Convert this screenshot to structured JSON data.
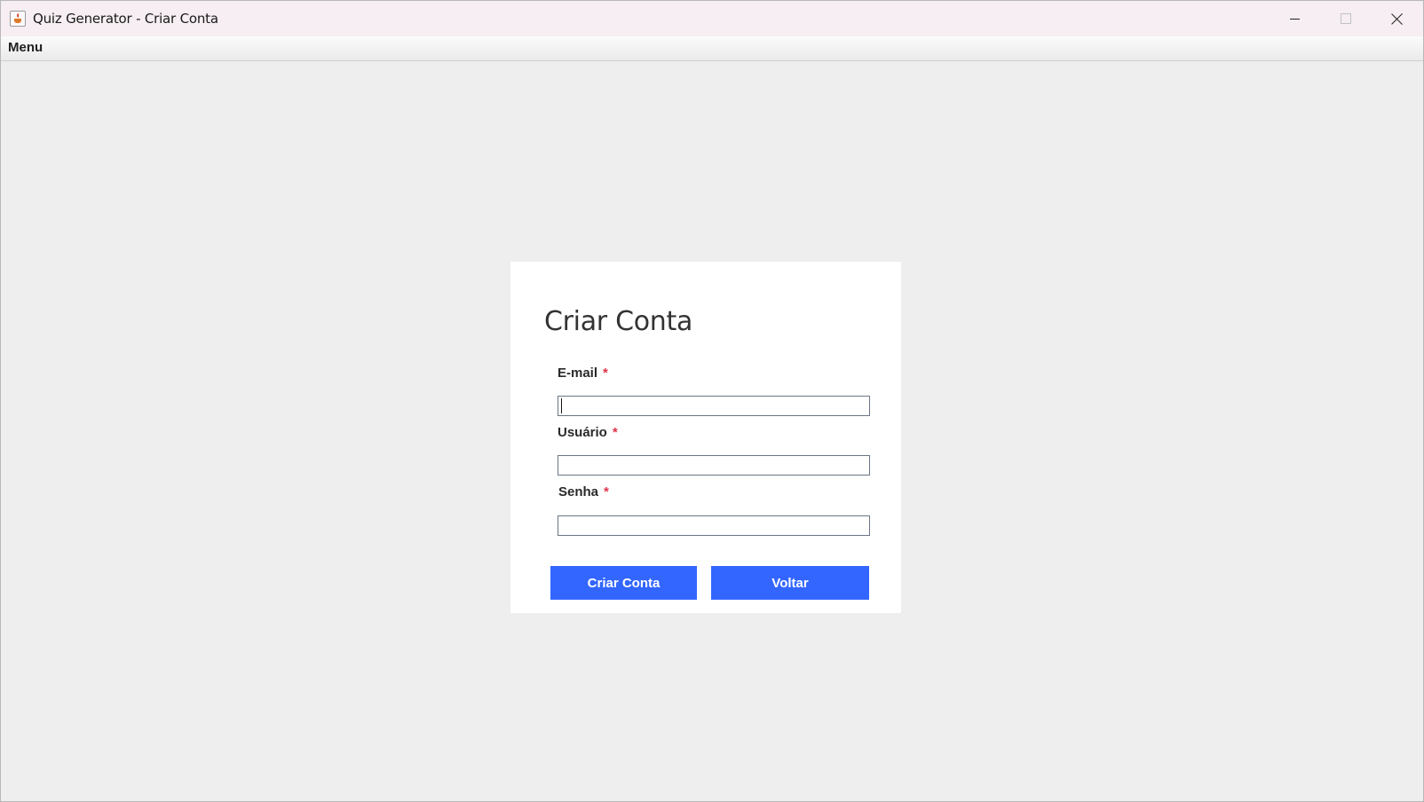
{
  "window": {
    "title": "Quiz Generator - Criar Conta",
    "icon": "java-cup-icon",
    "controls": [
      "minimize-icon",
      "maximize-icon",
      "close-icon"
    ]
  },
  "menubar": {
    "items": [
      {
        "label": "Menu"
      }
    ]
  },
  "form": {
    "title": "Criar Conta",
    "required_marker": "*",
    "fields": [
      {
        "label": "E-mail",
        "value": "",
        "placeholder": ""
      },
      {
        "label": "Usuário",
        "value": "",
        "placeholder": ""
      },
      {
        "label": "Senha",
        "value": "",
        "placeholder": ""
      }
    ],
    "buttons": {
      "create_label": "Criar Conta",
      "back_label": "Voltar"
    }
  },
  "colors": {
    "button_bg": "#3366ff",
    "button_text": "#ffffff",
    "required": "#e0344a",
    "window_bg": "#eeeeee",
    "card_bg": "#ffffff"
  }
}
